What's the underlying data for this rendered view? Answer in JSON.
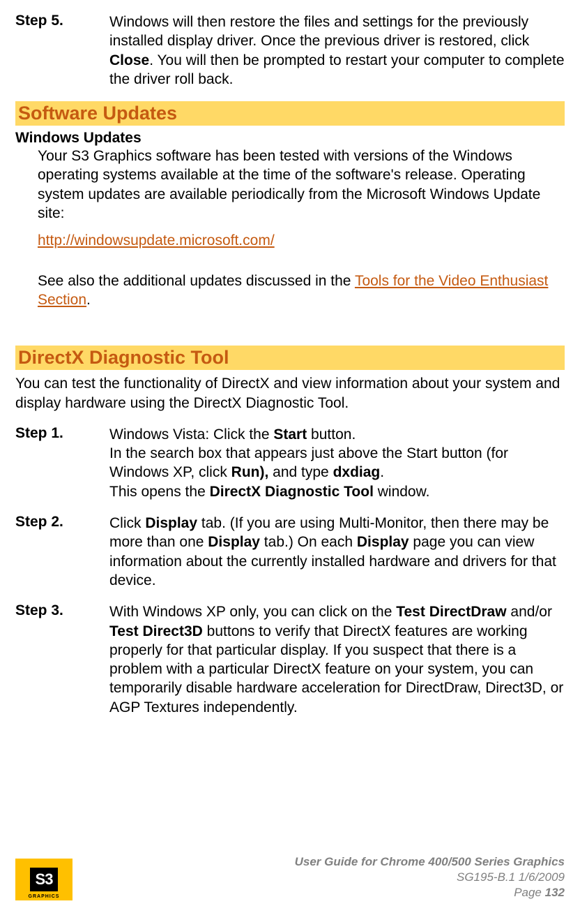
{
  "step5": {
    "label": "Step 5.",
    "text_before_close": "Windows will then restore the files and settings for the previously installed display driver. Once the previous driver is restored, click ",
    "close_word": "Close",
    "text_after_close": ". You will then be prompted to restart your computer to complete the driver roll back."
  },
  "software_updates": {
    "heading": "Software Updates",
    "sub": "Windows Updates",
    "body1": "Your S3 Graphics software has been tested with versions of the Windows operating systems available at the time of the software's release. Operating system updates are available periodically from the Microsoft Windows Update site:",
    "link1": "http://windowsupdate.microsoft.com/",
    "body2_pre": "See also the additional updates discussed in the ",
    "link2": "Tools for the Video Enthusiast Section",
    "body2_post": "."
  },
  "directx": {
    "heading": "DirectX Diagnostic Tool",
    "intro": "You can test the functionality of DirectX and view information about your system and display hardware using the DirectX Diagnostic Tool.",
    "step1": {
      "label": "Step 1.",
      "l1_pre": "Windows Vista: Click the ",
      "l1_b": "Start",
      "l1_post": " button.",
      "l2_pre": "In the search box that appears just above the Start button (for Windows XP, click ",
      "l2_b1": "Run),",
      "l2_mid": " and type ",
      "l2_b2": "dxdiag",
      "l2_post": ".",
      "l3_pre": "This opens the ",
      "l3_b": "DirectX Diagnostic Tool",
      "l3_post": " window."
    },
    "step2": {
      "label": "Step 2.",
      "pre": "Click ",
      "b1": "Display",
      "mid1": " tab. (If you are using Multi-Monitor, then there may be more than one ",
      "b2": "Display",
      "mid2": " tab.) On each ",
      "b3": "Display",
      "post": " page you can view information about the currently installed hardware and drivers for that device."
    },
    "step3": {
      "label": "Step 3.",
      "pre": "With Windows XP only, you can click on the ",
      "b1": "Test DirectDraw",
      "mid1": " and/or ",
      "b2": "Test Direct3D",
      "post": " buttons to verify that DirectX features are working properly for that particular display. If you suspect that there is a problem with a particular DirectX feature on your system, you can temporarily disable hardware acceleration for DirectDraw, Direct3D, or AGP Textures independently."
    }
  },
  "footer": {
    "logo_text": "S3",
    "logo_sub": "GRAPHICS",
    "title": "User Guide for Chrome 400/500 Series Graphics",
    "doc_id": "SG195-B.1   1/6/2009",
    "page_label": "Page ",
    "page_num": "132"
  }
}
